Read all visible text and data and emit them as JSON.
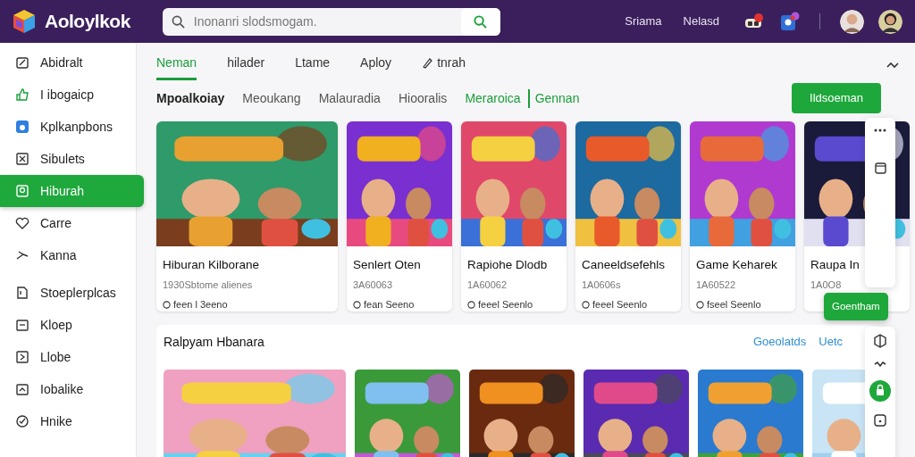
{
  "header": {
    "logo": "Aoloylkok",
    "search": {
      "placeholder": "Inonanri slodsmogam."
    },
    "nav_links": [
      "Sriama",
      "Nelasd"
    ]
  },
  "sidebar": {
    "items": [
      {
        "label": "Abidralt",
        "selected": false
      },
      {
        "label": "I ibogaicp",
        "selected": false
      },
      {
        "label": "Kplkanpbons",
        "selected": false
      },
      {
        "label": "Sibulets",
        "selected": false
      },
      {
        "label": "Hiburah",
        "selected": true
      },
      {
        "label": "Carre",
        "selected": false
      },
      {
        "label": "Kanna",
        "selected": false
      },
      {
        "label": "Stoeplerplcas",
        "selected": false
      },
      {
        "label": "Kloep",
        "selected": false
      },
      {
        "label": "Llobe",
        "selected": false
      },
      {
        "label": "Iobalike",
        "selected": false
      },
      {
        "label": "Hnike",
        "selected": false
      }
    ]
  },
  "tabs": [
    {
      "label": "Neman",
      "selected": true
    },
    {
      "label": "hilader",
      "selected": false
    },
    {
      "label": "Ltame",
      "selected": false
    },
    {
      "label": "Aploy",
      "selected": false
    },
    {
      "label": "tnrah",
      "selected": false
    }
  ],
  "filters": [
    {
      "label": "Mpoalkoiay",
      "selected": true,
      "color": "#222222"
    },
    {
      "label": "Meoukang",
      "selected": false,
      "color": "#555555"
    },
    {
      "label": "Malauradia",
      "selected": false,
      "color": "#555555"
    },
    {
      "label": "Hiooralis",
      "selected": false,
      "color": "#555555"
    },
    {
      "label": "Meraroica",
      "selected": false,
      "color": "#1a9e3a"
    },
    {
      "label": "Gennan",
      "selected": false,
      "color": "#1a9e3a"
    }
  ],
  "primary_button": "Ildsoeman",
  "cards": [
    {
      "title": "Hiburan  Kilborane",
      "meta": "1930Sbtome  alienes",
      "info": "feen l 3eeno"
    },
    {
      "title": "Senlert Oten",
      "meta": "3A60063",
      "info": "fean  Seeno"
    },
    {
      "title": "Rapiohe Dlodb",
      "meta": "1A60062",
      "info": "feeel Seenlo"
    },
    {
      "title": "Caneeldsefehls",
      "meta": "1A0606s",
      "info": "feeel Seenlo"
    },
    {
      "title": "Game Keharek",
      "meta": "1A60522",
      "info": "fseel Seenlo"
    },
    {
      "title": "Raupa In",
      "meta": "1A0O8"
    }
  ],
  "float_button": "Goentham",
  "section": {
    "title": "Ralpyam Hbanara",
    "links": [
      "Goeolatds",
      "Uetc"
    ]
  }
}
